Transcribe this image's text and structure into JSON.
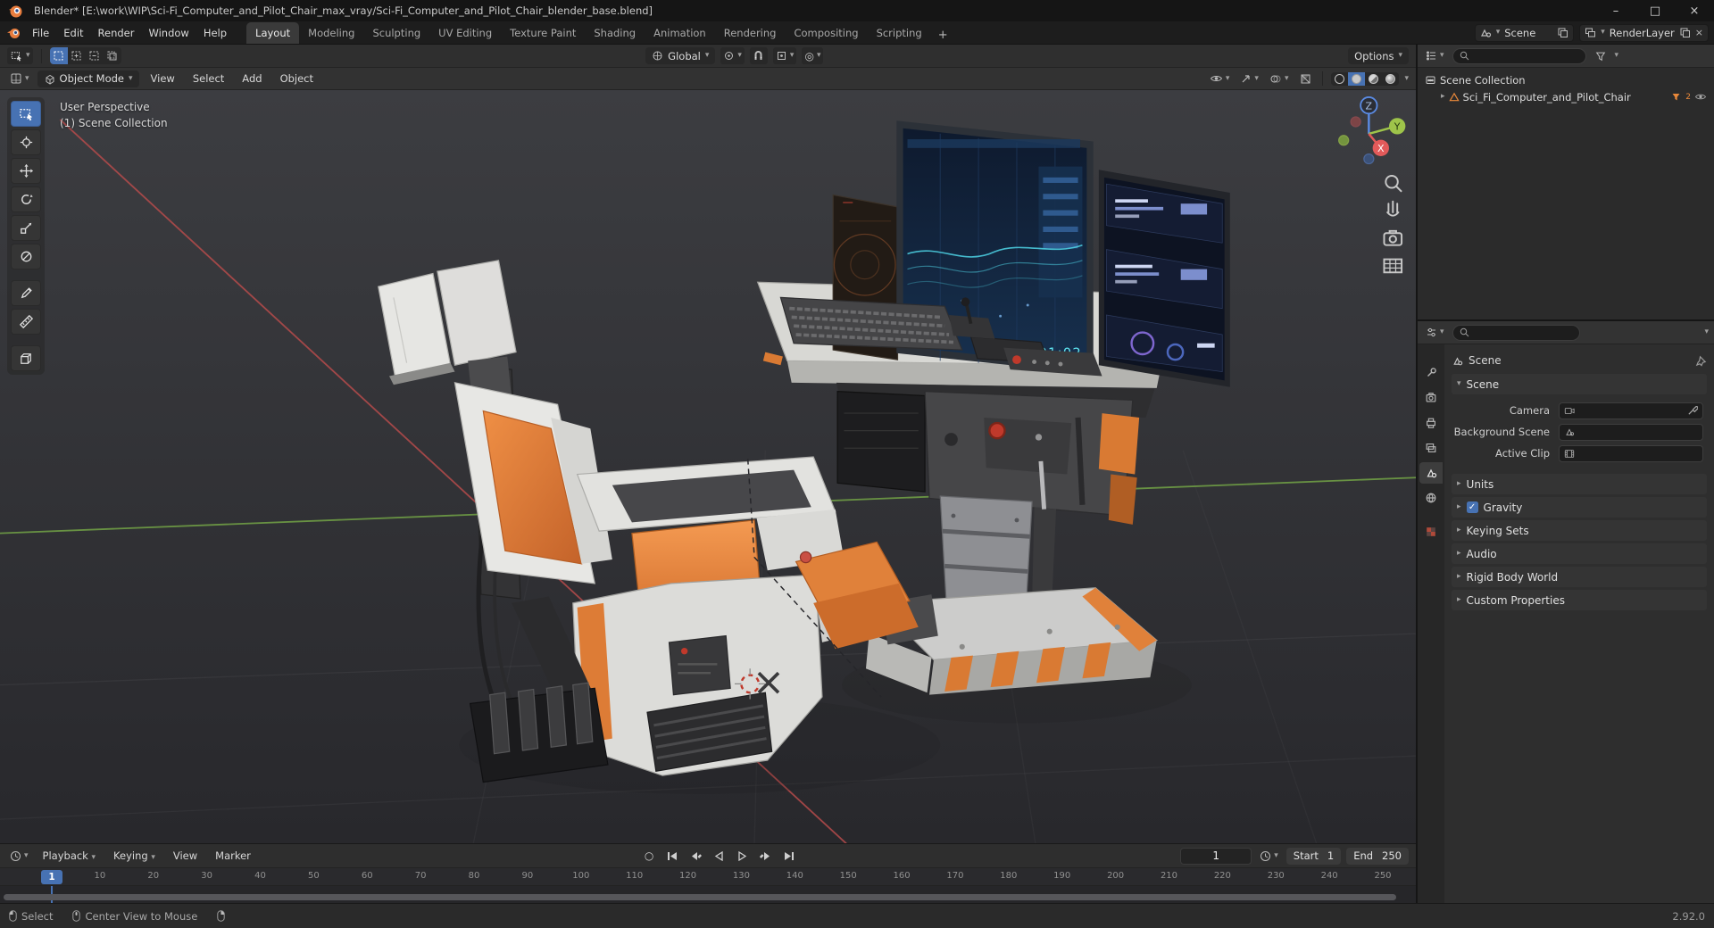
{
  "titlebar": {
    "title": "Blender* [E:\\work\\WIP\\Sci-Fi_Computer_and_Pilot_Chair_max_vray/Sci-Fi_Computer_and_Pilot_Chair_blender_base.blend]"
  },
  "icons": {
    "chevron_down": "▾",
    "chevron_right": "▸",
    "minimize": "–",
    "maximize": "□",
    "close": "×",
    "check": "✓",
    "plus": "+",
    "autokey": "○",
    "proportional": "◎"
  },
  "topbar": {
    "menus": [
      "File",
      "Edit",
      "Render",
      "Window",
      "Help"
    ],
    "workspaces": [
      "Layout",
      "Modeling",
      "Sculpting",
      "UV Editing",
      "Texture Paint",
      "Shading",
      "Animation",
      "Rendering",
      "Compositing",
      "Scripting"
    ],
    "scene": "Scene",
    "renderlayer": "RenderLayer"
  },
  "tool_settings": {
    "orientation": "Global",
    "options": "Options"
  },
  "viewport_header": {
    "mode": "Object Mode",
    "menus": [
      "View",
      "Select",
      "Add",
      "Object"
    ]
  },
  "viewport": {
    "overlay": [
      "User Perspective",
      "(1) Scene Collection"
    ],
    "gizmo": {
      "x": "X",
      "y": "Y",
      "z": "Z"
    },
    "monitor_time": "01:02"
  },
  "outliner": {
    "rows": [
      {
        "label": "Scene Collection"
      },
      {
        "label": "Sci_Fi_Computer_and_Pilot_Chair",
        "badge": "2"
      }
    ]
  },
  "properties": {
    "breadcrumb": "Scene",
    "panel_title": "Scene",
    "fields": [
      {
        "label": "Camera"
      },
      {
        "label": "Background Scene"
      },
      {
        "label": "Active Clip"
      }
    ],
    "panels": [
      {
        "label": "Units"
      },
      {
        "label": "Gravity",
        "checkbox": true
      },
      {
        "label": "Keying Sets"
      },
      {
        "label": "Audio"
      },
      {
        "label": "Rigid Body World"
      },
      {
        "label": "Custom Properties"
      }
    ]
  },
  "timeline": {
    "menus": [
      "Playback",
      "Keying",
      "View",
      "Marker"
    ],
    "current_frame": "1",
    "frame_value": "1",
    "start_label": "Start",
    "start_value": "1",
    "end_label": "End",
    "end_value": "250",
    "ticks": [
      "10",
      "20",
      "30",
      "40",
      "50",
      "60",
      "70",
      "80",
      "90",
      "100",
      "110",
      "120",
      "130",
      "140",
      "150",
      "160",
      "170",
      "180",
      "190",
      "200",
      "210",
      "220",
      "230",
      "240",
      "250"
    ]
  },
  "statusbar": {
    "hints": [
      "Select",
      "Center View to Mouse"
    ],
    "version": "2.92.0"
  }
}
